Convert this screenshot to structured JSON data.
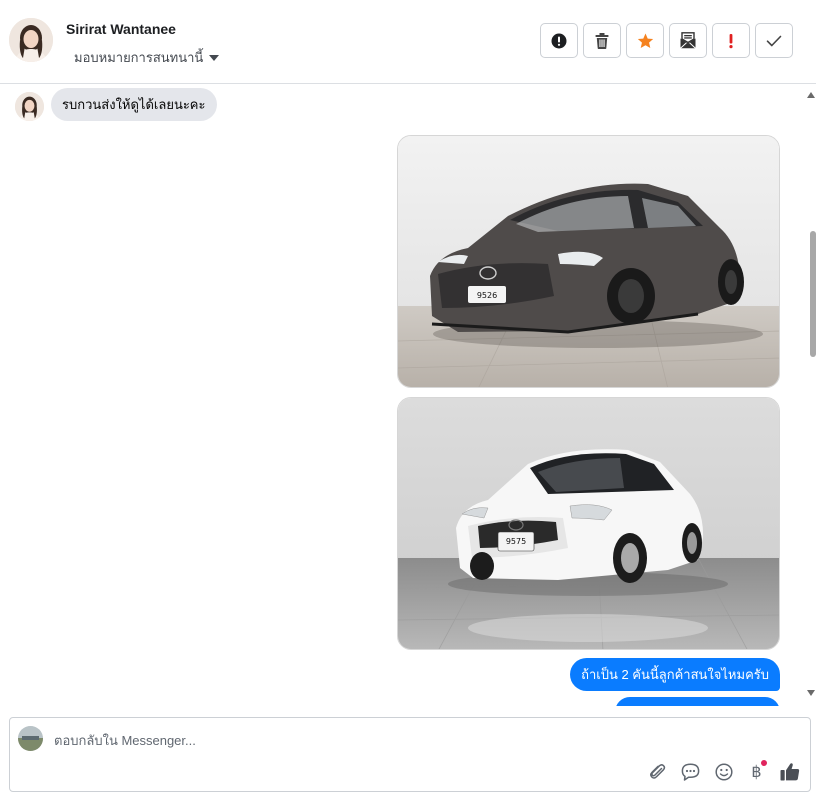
{
  "header": {
    "contact_name": "Sirirat Wantanee",
    "assign_label": "มอบหมายการสนทนานี้",
    "actions": [
      {
        "name": "report-spam-button",
        "icon": "exclamation-circle-icon"
      },
      {
        "name": "delete-button",
        "icon": "trash-icon"
      },
      {
        "name": "star-button",
        "icon": "star-icon"
      },
      {
        "name": "mark-unread-button",
        "icon": "envelope-icon"
      },
      {
        "name": "follow-up-button",
        "icon": "exclamation-icon"
      },
      {
        "name": "mark-done-button",
        "icon": "check-icon"
      }
    ]
  },
  "thread": {
    "incoming_message": "รบกวนส่งให้ดูได้เลยนะคะ",
    "photos": [
      {
        "caption": "",
        "plate": "กฉ 9526",
        "color": "#5a5654"
      },
      {
        "caption": "",
        "plate": "กน 9575",
        "color": "#f4f4f4"
      }
    ],
    "outgoing_message": "ถ้าเป็น 2 คันนี้ลูกค้าสนใจไหมครับ"
  },
  "composer": {
    "placeholder": "ตอบกลับใน Messenger...",
    "tools": [
      "paperclip-icon",
      "chat-bubble-icon",
      "emoji-icon",
      "baht-icon",
      "thumbs-up-icon"
    ]
  },
  "colors": {
    "accent_blue": "#0a7cff",
    "star_orange": "#f5821f",
    "alert_red": "#e02020",
    "incoming_bubble": "#e4e6eb"
  }
}
